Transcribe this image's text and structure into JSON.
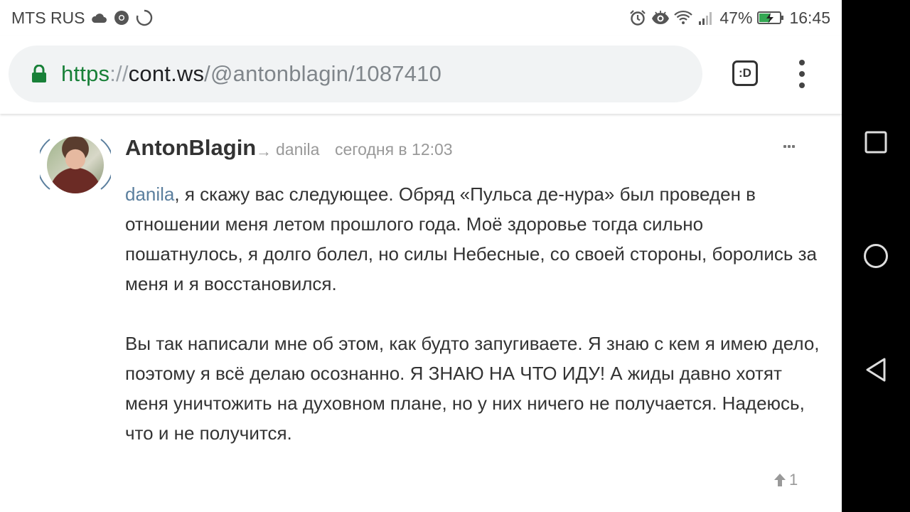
{
  "status_bar": {
    "carrier": "MTS RUS",
    "battery_percent": "47%",
    "time": "16:45",
    "left_icons": [
      "cloud-icon",
      "chrome-icon",
      "loading-circle-icon"
    ],
    "right_icons": [
      "alarm-icon",
      "eye-icon",
      "wifi-icon",
      "signal-icon",
      "battery-charging-icon"
    ]
  },
  "browser": {
    "url_scheme": "https",
    "url_separator": "://",
    "url_host": "cont.ws",
    "url_path": "/@antonblagin/1087410",
    "tab_switcher_label": ":D",
    "colors": {
      "scheme": "#188038",
      "lock": "#188038"
    }
  },
  "comment": {
    "author": "AntonBlagin",
    "reply_arrow": "→",
    "reply_to": "danila",
    "timestamp": "сегодня в 12:03",
    "mention": "danila",
    "paragraph_1_rest": ", я скажу вас следующее. Обряд «Пульса де-нура» был проведен в отношении меня летом прошлого года. Моё здоровье тогда сильно пошатнулось, я долго болел, но силы Небесные, со своей стороны, боролись за меня и я восстановился.",
    "paragraph_2": "Вы так написали мне об этом, как будто запугиваете. Я знаю с кем я имею дело, поэтому я всё делаю осознанно. Я ЗНАЮ НА ЧТО ИДУ! А жиды давно хотят меня уничтожить на духовном плане, но у них ничего не получается. Надеюсь, что и не получится.",
    "vote_count": "1",
    "colors": {
      "mention": "#5b7f9e"
    }
  },
  "nav_bar": {
    "buttons": [
      "recents-square-icon",
      "home-circle-icon",
      "back-triangle-icon"
    ]
  }
}
